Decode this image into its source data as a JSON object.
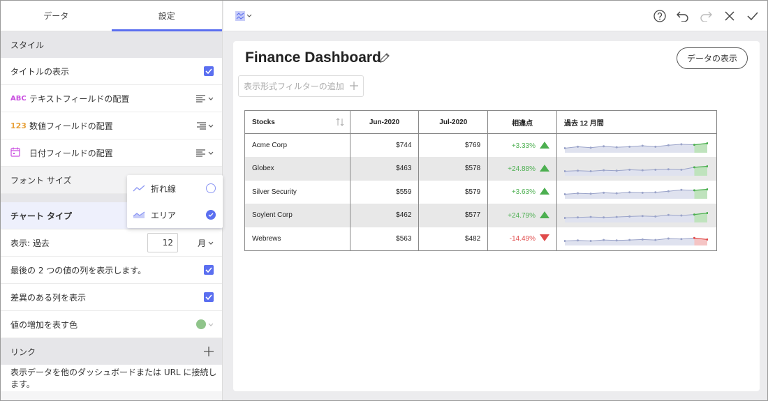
{
  "left_panel": {
    "tabs": [
      {
        "label": "データ",
        "active": false
      },
      {
        "label": "設定",
        "active": true
      }
    ],
    "style_section": "スタイル",
    "show_title": {
      "label": "タイトルの表示",
      "checked": true
    },
    "text_align": {
      "icon_text": "ABC",
      "label": "テキストフィールドの配置"
    },
    "number_align": {
      "icon_text": "123",
      "label": "数値フィールドの配置"
    },
    "date_align": {
      "label": "日付フィールドの配置"
    },
    "font_size": {
      "label": "フォント サイズ"
    },
    "chart_type": {
      "label": "チャート タイプ"
    },
    "display_past": {
      "label": "表示: 過去",
      "value": "12",
      "unit": "月"
    },
    "show_last_two": {
      "label": "最後の 2 つの値の列を表示します。",
      "checked": true
    },
    "show_diff": {
      "label": "差異のある列を表示",
      "checked": true
    },
    "increase_color": {
      "label": "値の増加を表す色",
      "color": "#8fc48a"
    },
    "link_section": "リンク",
    "link_desc": "表示データを他のダッシュボードまたは URL に接続します。"
  },
  "chart_type_popup": {
    "options": [
      {
        "label": "折れ線",
        "selected": false
      },
      {
        "label": "エリア",
        "selected": true
      }
    ]
  },
  "main": {
    "title": "Finance Dashboard",
    "view_data_button": "データの表示",
    "filter_placeholder": "表示形式フィルターの追加",
    "table": {
      "headers": [
        "Stocks",
        "Jun-2020",
        "Jul-2020",
        "相違点",
        "過去 12 月間"
      ],
      "rows": [
        {
          "name": "Acme Corp",
          "jun": "$744",
          "jul": "$769",
          "diff": "+3.33%",
          "trend": "up",
          "spark": [
            5,
            5.3,
            5.1,
            5.4,
            5.2,
            5.3,
            5.5,
            5.3,
            5.6,
            5.8,
            5.7,
            6
          ]
        },
        {
          "name": "Globex",
          "jun": "$463",
          "jul": "$578",
          "diff": "+24.88%",
          "trend": "up",
          "spark": [
            5,
            5.1,
            5.0,
            5.2,
            5.1,
            5.3,
            5.2,
            5.3,
            5.4,
            5.3,
            5.8,
            6
          ]
        },
        {
          "name": "Silver Security",
          "jun": "$559",
          "jul": "$579",
          "diff": "+3.63%",
          "trend": "up",
          "spark": [
            5,
            5.2,
            5.1,
            5.3,
            5.2,
            5.4,
            5.3,
            5.4,
            5.6,
            5.9,
            5.8,
            6
          ]
        },
        {
          "name": "Soylent Corp",
          "jun": "$462",
          "jul": "$577",
          "diff": "+24.79%",
          "trend": "up",
          "spark": [
            5,
            5.1,
            5.2,
            5.1,
            5.2,
            5.3,
            5.4,
            5.3,
            5.6,
            5.5,
            5.7,
            6
          ]
        },
        {
          "name": "Webrews",
          "jun": "$563",
          "jul": "$482",
          "diff": "-14.49%",
          "trend": "down",
          "spark": [
            5,
            5.1,
            5.0,
            5.2,
            5.1,
            5.2,
            5.3,
            5.2,
            5.5,
            5.4,
            5.6,
            5.3
          ]
        }
      ]
    }
  },
  "colors": {
    "accent": "#5b6ff0",
    "up": "#4caf50",
    "down": "#e04b4b",
    "spark_line": "#9aa3c9",
    "spark_fill": "#dfe2ef"
  }
}
